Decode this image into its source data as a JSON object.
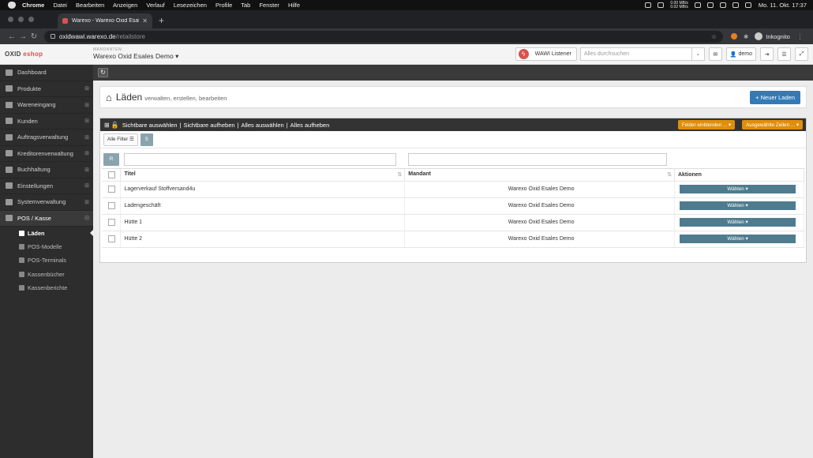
{
  "macos": {
    "menu": [
      "Chrome",
      "Datei",
      "Bearbeiten",
      "Anzeigen",
      "Verlauf",
      "Lesezeichen",
      "Profile",
      "Tab",
      "Fenster",
      "Hilfe"
    ],
    "net_up": "0.00 MB/s",
    "net_down": "0.02 MB/s",
    "clock": "Mo. 11. Okt. 17:37"
  },
  "browser": {
    "tab_title": "Warexo - Warexo Oxid Esales D",
    "url_host": "oxidwawi.warexo.de",
    "url_path": "/retailstore",
    "profile": "Inkognito"
  },
  "header": {
    "logo_a": "OXID",
    "logo_b": "eshop",
    "mandant_label": "MANDANTEN:",
    "mandant_value": "Warexo Oxid Esales Demo",
    "wawi_label": "WAWI Listener",
    "search_placeholder": "Alles durchsuchen",
    "user": "demo"
  },
  "sidebar": {
    "items": [
      {
        "label": "Dashboard",
        "icon": "home-icon",
        "pm": ""
      },
      {
        "label": "Produkte",
        "icon": "list-icon",
        "pm": "⊞"
      },
      {
        "label": "Wareneingang",
        "icon": "arrow-down-icon",
        "pm": "⊞"
      },
      {
        "label": "Kunden",
        "icon": "user-icon",
        "pm": "⊞"
      },
      {
        "label": "Auftragsverwaltung",
        "icon": "truck-icon",
        "pm": "⊞"
      },
      {
        "label": "Kreditorenverwaltung",
        "icon": "card-icon",
        "pm": "⊞"
      },
      {
        "label": "Buchhaltung",
        "icon": "briefcase-icon",
        "pm": "⊞"
      },
      {
        "label": "Einstellungen",
        "icon": "wrench-icon",
        "pm": "⊞"
      },
      {
        "label": "Systemverwaltung",
        "icon": "cogs-icon",
        "pm": "⊞"
      },
      {
        "label": "POS / Kasse",
        "icon": "cart-icon",
        "pm": "⊟"
      }
    ],
    "sub": [
      {
        "label": "Läden",
        "icon": "user-icon"
      },
      {
        "label": "POS-Modelle",
        "icon": "card-icon"
      },
      {
        "label": "POS-Terminals",
        "icon": "card-icon"
      },
      {
        "label": "Kassenbücher",
        "icon": "book-icon"
      },
      {
        "label": "Kassenberichte",
        "icon": "book-icon"
      }
    ]
  },
  "page": {
    "title": "Läden",
    "subtitle": "verwalten, erstellen, bearbeiten",
    "new_button": "+ Neuer Laden"
  },
  "panel": {
    "actions": [
      "Sichtbare auswählen",
      "Sichtbare aufheben",
      "Alles auswählen",
      "Alles aufheben"
    ],
    "fields_btn": "Felder einblenden ...",
    "selected_btn": "Ausgewählte Zeilen ...",
    "all_filter": "Alle Filter",
    "s_btn": "S",
    "r_btn": "R"
  },
  "table": {
    "columns": [
      "Titel",
      "Mandant",
      "Aktionen"
    ],
    "action_label": "Wählen",
    "rows": [
      {
        "title": "Lagerverkauf Stoffversand4u",
        "mandant": "Warexo Oxid Esales Demo"
      },
      {
        "title": "Ladengeschäft",
        "mandant": "Warexo Oxid Esales Demo"
      },
      {
        "title": "Hütte 1",
        "mandant": "Warexo Oxid Esales Demo"
      },
      {
        "title": "Hütte 2",
        "mandant": "Warexo Oxid Esales Demo"
      }
    ]
  }
}
